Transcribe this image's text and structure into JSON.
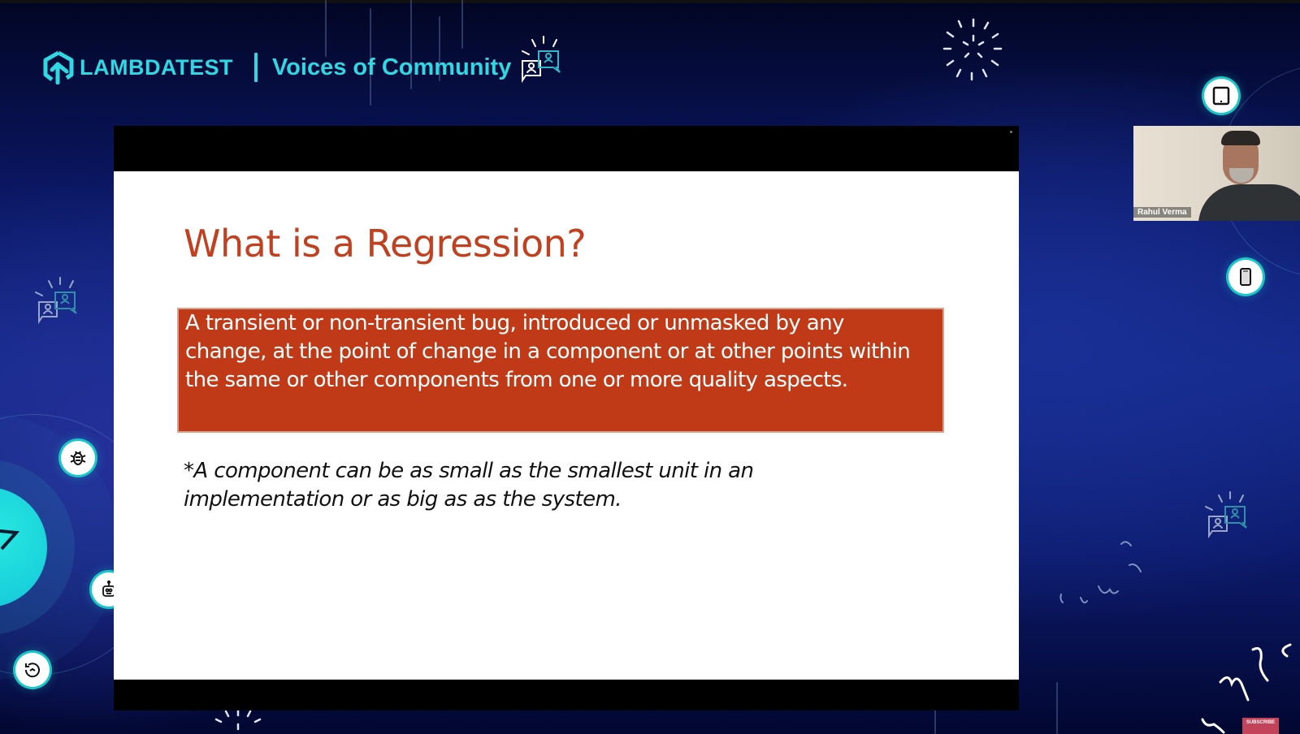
{
  "header": {
    "brand": "LAMBDATEST",
    "event_title": "Voices of Community"
  },
  "slide": {
    "title": "What is a Regression?",
    "definition": "A transient or non-transient bug, introduced or unmasked by any change, at the point of change in a component or at other points within the same or other components from one or more quality aspects.",
    "note": "*A component can be as small as the smallest unit in an implementation or as big as as the system."
  },
  "speaker": {
    "name": "Rahul Verma"
  },
  "colors": {
    "accent": "#2fd8e2",
    "slide_title": "#c0401f",
    "definition_box": "#c13a18",
    "background_deep": "#0a1660",
    "subscribe": "#c2435a"
  },
  "icons": [
    "lambdatest-logo-icon",
    "chat-people-icon",
    "tablet-icon",
    "mobile-icon",
    "bug-icon",
    "robot-icon",
    "clock-refresh-icon",
    "fireworks-icon"
  ],
  "subscribe_label": "SUBSCRIBE"
}
